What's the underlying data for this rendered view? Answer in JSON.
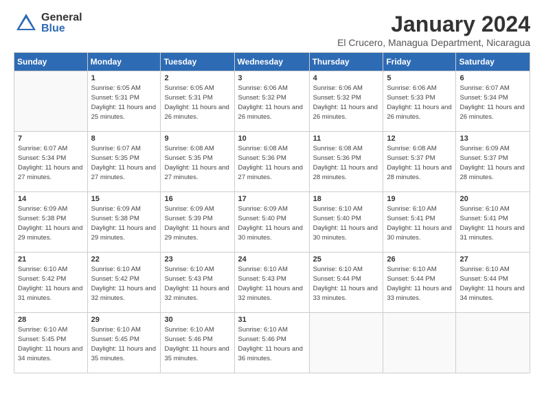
{
  "logo": {
    "line1": "General",
    "line2": "Blue"
  },
  "title": "January 2024",
  "subtitle": "El Crucero, Managua Department, Nicaragua",
  "weekdays": [
    "Sunday",
    "Monday",
    "Tuesday",
    "Wednesday",
    "Thursday",
    "Friday",
    "Saturday"
  ],
  "weeks": [
    [
      {
        "day": "",
        "sunrise": "",
        "sunset": "",
        "daylight": ""
      },
      {
        "day": "1",
        "sunrise": "Sunrise: 6:05 AM",
        "sunset": "Sunset: 5:31 PM",
        "daylight": "Daylight: 11 hours and 25 minutes."
      },
      {
        "day": "2",
        "sunrise": "Sunrise: 6:05 AM",
        "sunset": "Sunset: 5:31 PM",
        "daylight": "Daylight: 11 hours and 26 minutes."
      },
      {
        "day": "3",
        "sunrise": "Sunrise: 6:06 AM",
        "sunset": "Sunset: 5:32 PM",
        "daylight": "Daylight: 11 hours and 26 minutes."
      },
      {
        "day": "4",
        "sunrise": "Sunrise: 6:06 AM",
        "sunset": "Sunset: 5:32 PM",
        "daylight": "Daylight: 11 hours and 26 minutes."
      },
      {
        "day": "5",
        "sunrise": "Sunrise: 6:06 AM",
        "sunset": "Sunset: 5:33 PM",
        "daylight": "Daylight: 11 hours and 26 minutes."
      },
      {
        "day": "6",
        "sunrise": "Sunrise: 6:07 AM",
        "sunset": "Sunset: 5:34 PM",
        "daylight": "Daylight: 11 hours and 26 minutes."
      }
    ],
    [
      {
        "day": "7",
        "sunrise": "Sunrise: 6:07 AM",
        "sunset": "Sunset: 5:34 PM",
        "daylight": "Daylight: 11 hours and 27 minutes."
      },
      {
        "day": "8",
        "sunrise": "Sunrise: 6:07 AM",
        "sunset": "Sunset: 5:35 PM",
        "daylight": "Daylight: 11 hours and 27 minutes."
      },
      {
        "day": "9",
        "sunrise": "Sunrise: 6:08 AM",
        "sunset": "Sunset: 5:35 PM",
        "daylight": "Daylight: 11 hours and 27 minutes."
      },
      {
        "day": "10",
        "sunrise": "Sunrise: 6:08 AM",
        "sunset": "Sunset: 5:36 PM",
        "daylight": "Daylight: 11 hours and 27 minutes."
      },
      {
        "day": "11",
        "sunrise": "Sunrise: 6:08 AM",
        "sunset": "Sunset: 5:36 PM",
        "daylight": "Daylight: 11 hours and 28 minutes."
      },
      {
        "day": "12",
        "sunrise": "Sunrise: 6:08 AM",
        "sunset": "Sunset: 5:37 PM",
        "daylight": "Daylight: 11 hours and 28 minutes."
      },
      {
        "day": "13",
        "sunrise": "Sunrise: 6:09 AM",
        "sunset": "Sunset: 5:37 PM",
        "daylight": "Daylight: 11 hours and 28 minutes."
      }
    ],
    [
      {
        "day": "14",
        "sunrise": "Sunrise: 6:09 AM",
        "sunset": "Sunset: 5:38 PM",
        "daylight": "Daylight: 11 hours and 29 minutes."
      },
      {
        "day": "15",
        "sunrise": "Sunrise: 6:09 AM",
        "sunset": "Sunset: 5:38 PM",
        "daylight": "Daylight: 11 hours and 29 minutes."
      },
      {
        "day": "16",
        "sunrise": "Sunrise: 6:09 AM",
        "sunset": "Sunset: 5:39 PM",
        "daylight": "Daylight: 11 hours and 29 minutes."
      },
      {
        "day": "17",
        "sunrise": "Sunrise: 6:09 AM",
        "sunset": "Sunset: 5:40 PM",
        "daylight": "Daylight: 11 hours and 30 minutes."
      },
      {
        "day": "18",
        "sunrise": "Sunrise: 6:10 AM",
        "sunset": "Sunset: 5:40 PM",
        "daylight": "Daylight: 11 hours and 30 minutes."
      },
      {
        "day": "19",
        "sunrise": "Sunrise: 6:10 AM",
        "sunset": "Sunset: 5:41 PM",
        "daylight": "Daylight: 11 hours and 30 minutes."
      },
      {
        "day": "20",
        "sunrise": "Sunrise: 6:10 AM",
        "sunset": "Sunset: 5:41 PM",
        "daylight": "Daylight: 11 hours and 31 minutes."
      }
    ],
    [
      {
        "day": "21",
        "sunrise": "Sunrise: 6:10 AM",
        "sunset": "Sunset: 5:42 PM",
        "daylight": "Daylight: 11 hours and 31 minutes."
      },
      {
        "day": "22",
        "sunrise": "Sunrise: 6:10 AM",
        "sunset": "Sunset: 5:42 PM",
        "daylight": "Daylight: 11 hours and 32 minutes."
      },
      {
        "day": "23",
        "sunrise": "Sunrise: 6:10 AM",
        "sunset": "Sunset: 5:43 PM",
        "daylight": "Daylight: 11 hours and 32 minutes."
      },
      {
        "day": "24",
        "sunrise": "Sunrise: 6:10 AM",
        "sunset": "Sunset: 5:43 PM",
        "daylight": "Daylight: 11 hours and 32 minutes."
      },
      {
        "day": "25",
        "sunrise": "Sunrise: 6:10 AM",
        "sunset": "Sunset: 5:44 PM",
        "daylight": "Daylight: 11 hours and 33 minutes."
      },
      {
        "day": "26",
        "sunrise": "Sunrise: 6:10 AM",
        "sunset": "Sunset: 5:44 PM",
        "daylight": "Daylight: 11 hours and 33 minutes."
      },
      {
        "day": "27",
        "sunrise": "Sunrise: 6:10 AM",
        "sunset": "Sunset: 5:44 PM",
        "daylight": "Daylight: 11 hours and 34 minutes."
      }
    ],
    [
      {
        "day": "28",
        "sunrise": "Sunrise: 6:10 AM",
        "sunset": "Sunset: 5:45 PM",
        "daylight": "Daylight: 11 hours and 34 minutes."
      },
      {
        "day": "29",
        "sunrise": "Sunrise: 6:10 AM",
        "sunset": "Sunset: 5:45 PM",
        "daylight": "Daylight: 11 hours and 35 minutes."
      },
      {
        "day": "30",
        "sunrise": "Sunrise: 6:10 AM",
        "sunset": "Sunset: 5:46 PM",
        "daylight": "Daylight: 11 hours and 35 minutes."
      },
      {
        "day": "31",
        "sunrise": "Sunrise: 6:10 AM",
        "sunset": "Sunset: 5:46 PM",
        "daylight": "Daylight: 11 hours and 36 minutes."
      },
      {
        "day": "",
        "sunrise": "",
        "sunset": "",
        "daylight": ""
      },
      {
        "day": "",
        "sunrise": "",
        "sunset": "",
        "daylight": ""
      },
      {
        "day": "",
        "sunrise": "",
        "sunset": "",
        "daylight": ""
      }
    ]
  ]
}
